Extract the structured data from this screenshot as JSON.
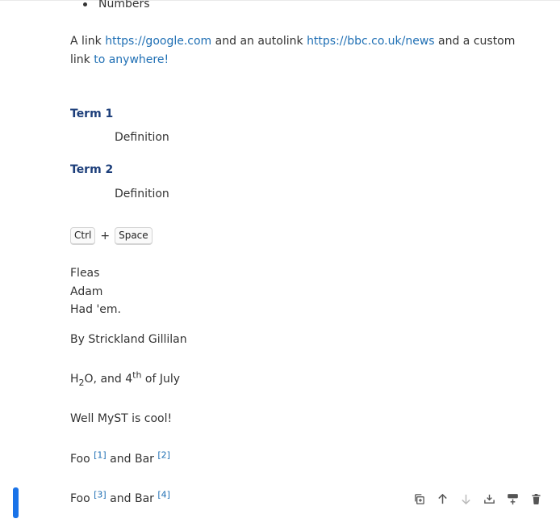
{
  "list": {
    "last_item": "Numbers"
  },
  "links_para": {
    "text1": "A link ",
    "link1": "https://google.com",
    "text2": " and an autolink ",
    "link2": "https://bbc.co.uk/news",
    "text3": " and a custom link ",
    "link3": "to anywhere!"
  },
  "definitions": [
    {
      "term": "Term 1",
      "definition": "Definition"
    },
    {
      "term": "Term 2",
      "definition": "Definition"
    }
  ],
  "keyboard": {
    "key1": "Ctrl",
    "plus": "+",
    "key2": "Space"
  },
  "poem": {
    "line1": "Fleas",
    "line2": "Adam",
    "line3": "Had 'em.",
    "attribution": "By Strickland Gillilan"
  },
  "subsup": {
    "h": "H",
    "sub": "2",
    "o_and": "O, and 4",
    "sup": "th",
    "of_july": " of July"
  },
  "myst": {
    "text": "Well MyST is cool!"
  },
  "footnotes1": {
    "foo": "Foo ",
    "ref1": "[1]",
    "and_bar": " and Bar ",
    "ref2": "[2]"
  },
  "footnotes2": {
    "foo": "Foo ",
    "ref1": "[3]",
    "and_bar": " and Bar ",
    "ref2": "[4]"
  },
  "colors": {
    "link": "#1f6fb4",
    "term": "#1c3e7a",
    "selection": "#1a73e8",
    "toolbar_icon": "#555555",
    "toolbar_icon_disabled": "#bbbbbb"
  },
  "toolbar": {
    "icons": [
      "copy-icon",
      "arrow-up-icon",
      "arrow-down-icon",
      "insert-below-icon",
      "insert-above-icon",
      "trash-icon"
    ]
  }
}
